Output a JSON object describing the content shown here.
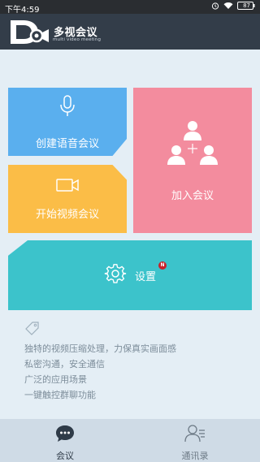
{
  "status_bar": {
    "time": "下午4:59",
    "battery": "87"
  },
  "header": {
    "logo_main": "多视会议",
    "logo_sub": "multi video meeting"
  },
  "tiles": {
    "voice_meeting": "创建语音会议",
    "video_meeting": "开始视频会议",
    "join_meeting": "加入会议",
    "settings": "设置",
    "settings_badge": "N"
  },
  "features": [
    "独特的视频压缩处理，力保真实画面感",
    "私密沟通，安全通信",
    "广泛的应用场景",
    "一键触控群聊功能"
  ],
  "tabbar": {
    "meeting": "会议",
    "contacts": "通讯录"
  },
  "colors": {
    "voice": "#5aafee",
    "video": "#fbbd47",
    "join": "#f38c9e",
    "settings": "#3cc3cb",
    "header": "#333d49"
  }
}
